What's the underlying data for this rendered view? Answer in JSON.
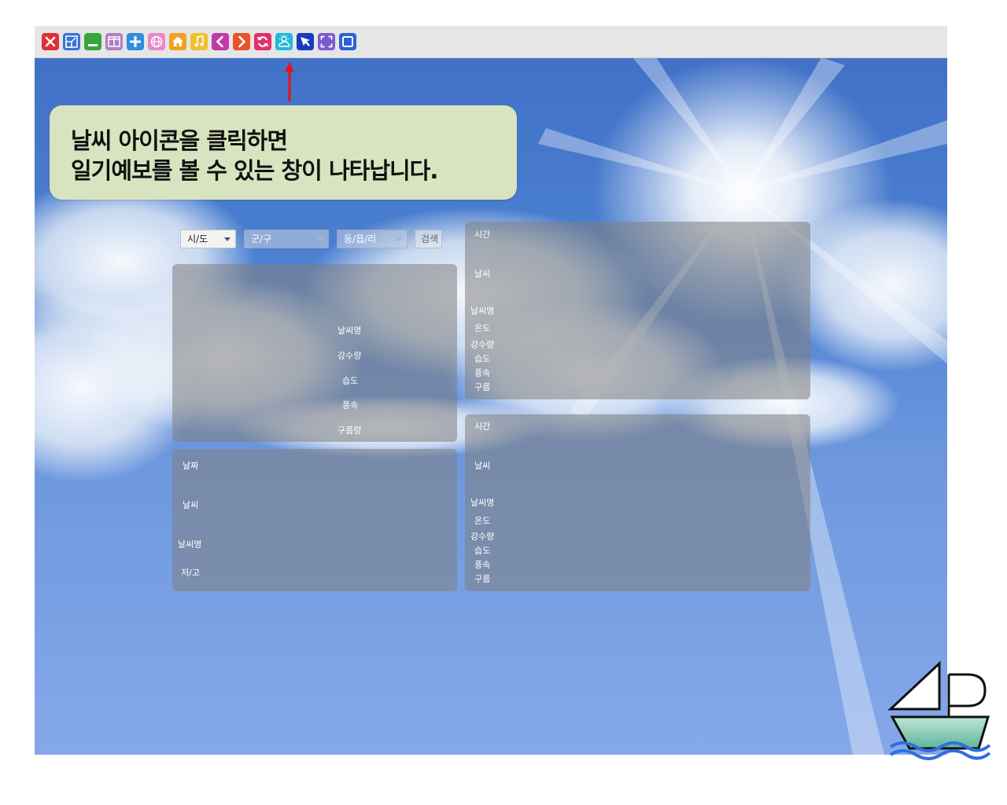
{
  "toolbar": {
    "icons": [
      {
        "name": "close-icon",
        "color": "#e0303a"
      },
      {
        "name": "shrink-window-icon",
        "color": "#3a72d8"
      },
      {
        "name": "minimize-icon",
        "color": "#3aa63a"
      },
      {
        "name": "split-view-icon",
        "color": "#b57ec4"
      },
      {
        "name": "add-icon",
        "color": "#2f8ee0"
      },
      {
        "name": "globe-icon",
        "color": "#e88ac8"
      },
      {
        "name": "home-icon",
        "color": "#f2a020"
      },
      {
        "name": "music-icon",
        "color": "#f0c030"
      },
      {
        "name": "back-icon",
        "color": "#c23aa8"
      },
      {
        "name": "forward-icon",
        "color": "#e8542a"
      },
      {
        "name": "refresh-icon",
        "color": "#e0306a"
      },
      {
        "name": "weather-icon",
        "color": "#20b8d8"
      },
      {
        "name": "pin-icon",
        "color": "#1a3ac0"
      },
      {
        "name": "fullscreen-icon",
        "color": "#7b5cd0"
      },
      {
        "name": "window-icon",
        "color": "#2a62d8"
      }
    ]
  },
  "callout": {
    "line1": "날씨 아이콘을 클릭하면",
    "line2": "일기예보를 볼 수 있는 창이 나타납니다.",
    "arrow_color": "#e8101a"
  },
  "search": {
    "sido": "시/도",
    "gugun": "군/구",
    "dong": "동/읍/리",
    "button": "검색"
  },
  "current_panel": {
    "labels": [
      "날씨명",
      "강수량",
      "습도",
      "풍속",
      "구름량"
    ]
  },
  "daily_panel": {
    "labels": [
      "날짜",
      "날씨",
      "날씨명",
      "저/고"
    ]
  },
  "hourly_panel_1": {
    "labels": [
      "시간",
      "날씨",
      "날씨명",
      "온도",
      "강수량",
      "습도",
      "풍속",
      "구름"
    ]
  },
  "hourly_panel_2": {
    "labels": [
      "시간",
      "날씨",
      "날씨명",
      "온도",
      "강수량",
      "습도",
      "풍속",
      "구름"
    ]
  }
}
